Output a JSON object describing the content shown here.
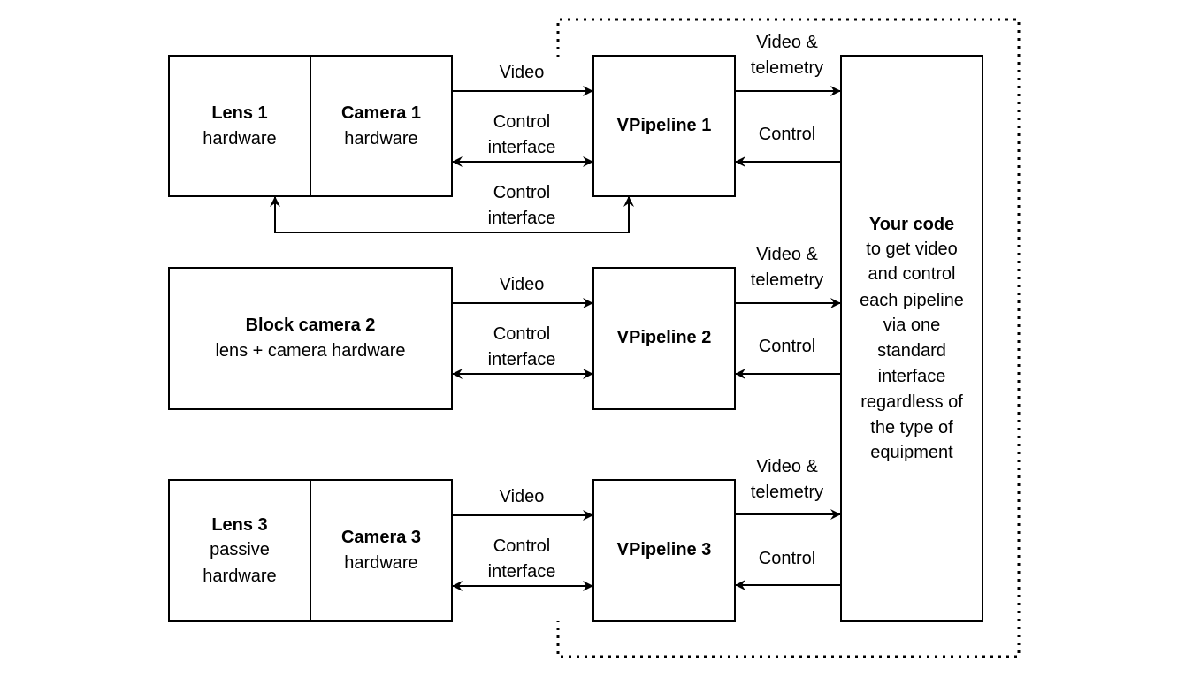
{
  "lens1": {
    "title": "Lens 1",
    "subtitle": "hardware"
  },
  "camera1": {
    "title": "Camera 1",
    "subtitle": "hardware"
  },
  "vpipeline1": {
    "title": "VPipeline 1"
  },
  "block_camera2": {
    "title": "Block camera 2",
    "subtitle": "lens + camera hardware"
  },
  "vpipeline2": {
    "title": "VPipeline 2"
  },
  "lens3": {
    "title": "Lens 3",
    "line2": "passive",
    "line3": "hardware"
  },
  "camera3": {
    "title": "Camera 3",
    "subtitle": "hardware"
  },
  "vpipeline3": {
    "title": "VPipeline 3"
  },
  "your_code": {
    "title": "Your code",
    "lines": [
      "to get video",
      "and control",
      "each pipeline",
      "via one",
      "standard",
      "interface",
      "regardless of",
      "the type of",
      "equipment"
    ]
  },
  "edges": {
    "video": "Video",
    "control_interface": [
      "Control",
      "interface"
    ],
    "video_telemetry": [
      "Video &",
      "telemetry"
    ],
    "control": "Control"
  }
}
